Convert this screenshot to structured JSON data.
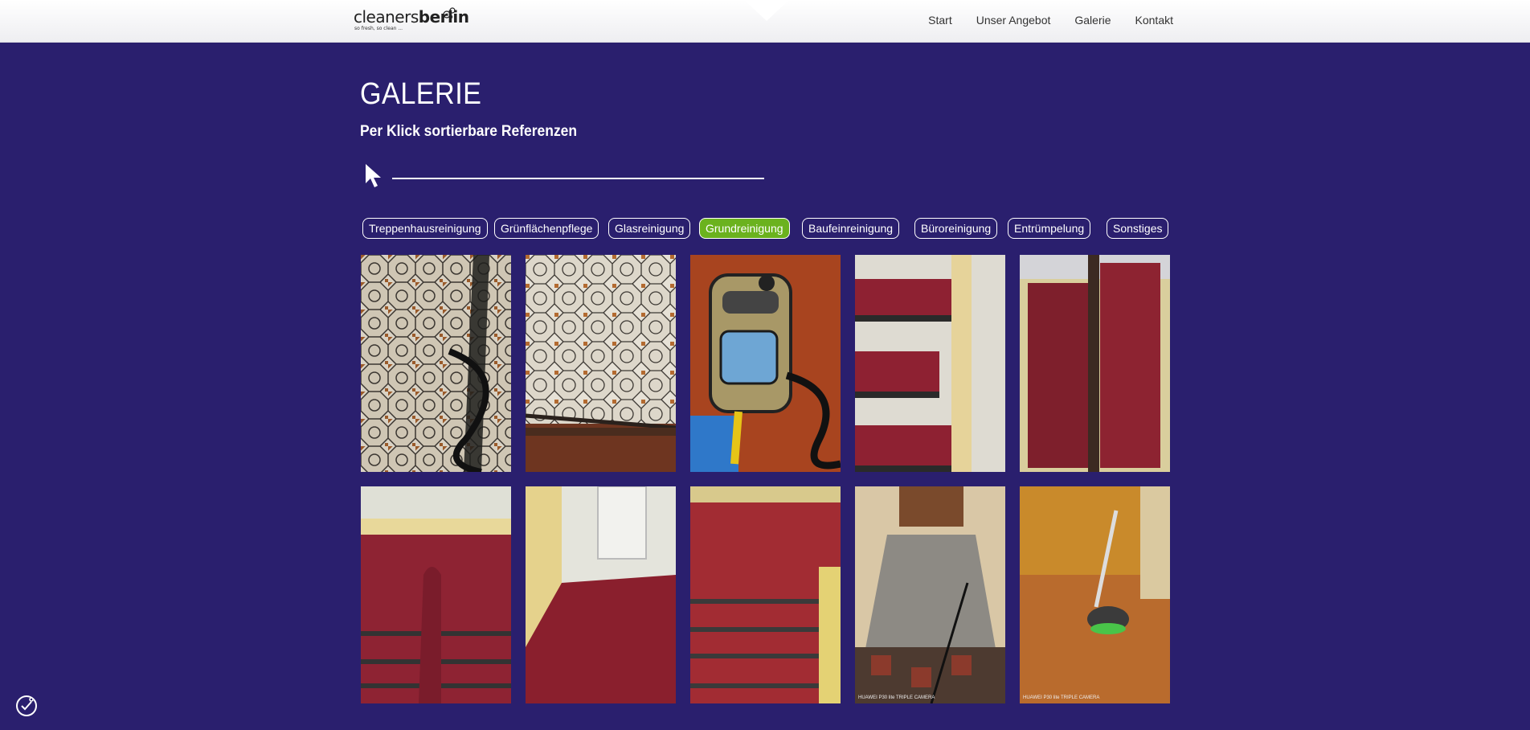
{
  "logo": {
    "text_plain": "cleaners",
    "text_bold": "berlin",
    "tagline": "so fresh, so clean ..."
  },
  "nav": [
    "Start",
    "Unser Angebot",
    "Galerie",
    "Kontakt"
  ],
  "page": {
    "title": "GALERIE",
    "subtitle": "Per Klick sortierbare Referenzen"
  },
  "filters": [
    {
      "label": "Treppenhausreinigung",
      "active": false
    },
    {
      "label": "Grünflächenpflege",
      "active": false
    },
    {
      "label": "Glasreinigung",
      "active": false
    },
    {
      "label": "Grundreinigung",
      "active": true
    },
    {
      "label": "Baufeinreinigung",
      "active": false
    },
    {
      "label": "Büroreinigung",
      "active": false
    },
    {
      "label": "Entrümpelung",
      "active": false
    },
    {
      "label": "Sonstiges",
      "active": false
    }
  ],
  "gallery": [
    {
      "name": "patterned-tile-floor-photo"
    },
    {
      "name": "patterned-tile-floor-photo"
    },
    {
      "name": "steam-cleaner-photo"
    },
    {
      "name": "red-stairs-photo"
    },
    {
      "name": "red-stairs-photo"
    },
    {
      "name": "red-staircase-photo"
    },
    {
      "name": "red-floor-photo"
    },
    {
      "name": "red-stairs-photo"
    },
    {
      "name": "hallway-floor-photo",
      "caption": "HUAWEI P30 lite TRIPLE CAMERA"
    },
    {
      "name": "floor-machine-photo",
      "caption": "HUAWEI P30 lite TRIPLE CAMERA"
    }
  ],
  "colors": {
    "background": "#2a1f6e",
    "active_filter": "#6bb21e",
    "topbar": "#f4f4f6"
  }
}
